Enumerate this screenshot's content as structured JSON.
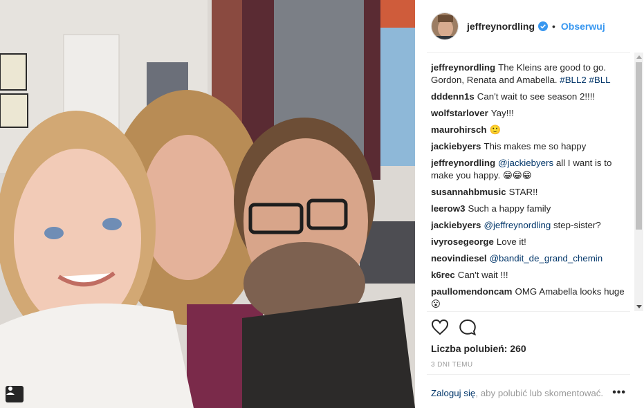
{
  "post": {
    "username": "jeffreynordling",
    "separator": "•",
    "follow_label": "Obserwuj",
    "comments": [
      {
        "user": "jeffreynordling",
        "text": "The Kleins are good to go. Gordon, Renata and Amabella.",
        "tags": "#BLL2 #BLL"
      },
      {
        "user": "dddenn1s",
        "text": "Can't wait to see season 2!!!!"
      },
      {
        "user": "wolfstarlover",
        "text": "Yay!!!"
      },
      {
        "user": "maurohirsch",
        "text": "🙂"
      },
      {
        "user": "jackiebyers",
        "text": "This makes me so happy"
      },
      {
        "user": "jeffreynordling",
        "mention": "@jackiebyers",
        "text": "all I want is to make you happy. 😁😁😁"
      },
      {
        "user": "susannahbmusic",
        "text": "STAR!!"
      },
      {
        "user": "leerow3",
        "text": "Such a happy family"
      },
      {
        "user": "jackiebyers",
        "mention": "@jeffreynordling",
        "text": "step-sister?"
      },
      {
        "user": "ivyrosegeorge",
        "text": "Love it!"
      },
      {
        "user": "neovindiesel",
        "mention": "@bandit_de_grand_chemin",
        "text": ""
      },
      {
        "user": "k6rec",
        "text": "Can't wait !!!"
      },
      {
        "user": "paullomendoncam",
        "text": "OMG Amabella looks huge 😮"
      }
    ],
    "likes_text": "Liczba polubień: 260",
    "time_ago": "3 dni temu",
    "footer": {
      "login_label": "Zaloguj się",
      "rest": ", aby polubić lub skomentować.",
      "more": "•••"
    }
  },
  "icons": {
    "like": "heart-icon",
    "comment": "comment-icon",
    "verified": "verified-badge-icon",
    "user_tag": "user-tag-icon"
  },
  "colors": {
    "link_blue": "#3897f0",
    "tag_blue": "#003569",
    "muted": "#999999",
    "text": "#262626"
  }
}
